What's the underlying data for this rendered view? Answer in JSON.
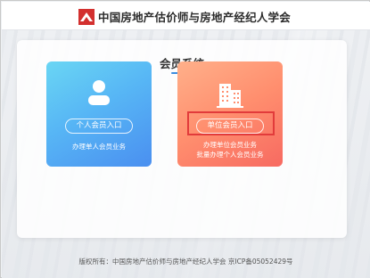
{
  "header": {
    "title": "中国房地产估价师与房地产经纪人学会",
    "logo_icon": "association-logo-icon",
    "logo_color": "#d3302f"
  },
  "panel": {
    "title": "会员系统",
    "accent_color": "#3b8de0"
  },
  "cards": [
    {
      "id": "personal",
      "icon": "person-icon",
      "button_label": "个人会员入口",
      "descriptions": [
        "办理单人会员业务"
      ],
      "colors": [
        "#6ad6f4",
        "#4a8ff0"
      ]
    },
    {
      "id": "unit",
      "icon": "building-icon",
      "button_label": "单位会员入口",
      "descriptions": [
        "办理单位会员业务",
        "批量办理个人会员业务"
      ],
      "colors": [
        "#ffb08a",
        "#f76a61"
      ],
      "highlighted": true,
      "highlight_color": "#e23b3b"
    }
  ],
  "footer": {
    "text": "版权所有：中国房地产估价师与房地产经纪人学会 京ICP备05052429号"
  }
}
